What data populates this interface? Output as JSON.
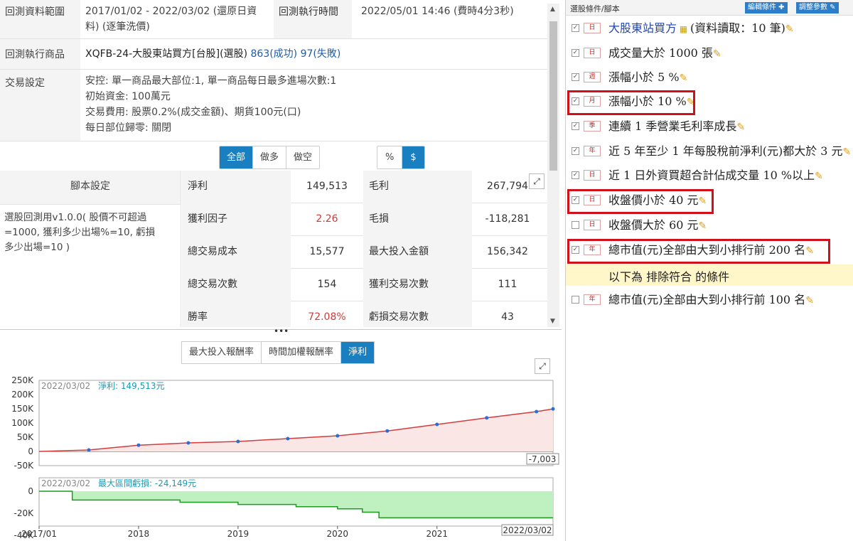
{
  "info": {
    "range_label": "回測資料範圍",
    "range_value_line1": "2017/01/02 - 2022/03/02 (還原日資",
    "range_value_line2": "料) (逐筆洗價)",
    "exec_time_label": "回測執行時間",
    "exec_time_value": "2022/05/01 14:46 (費時4分3秒)",
    "product_label": "回測執行商品",
    "product_value": "XQFB-24-大股東站買方[台股](選股)",
    "product_success": "863(成功)",
    "product_fail": "97(失敗)",
    "trade_label": "交易設定",
    "trade_lines": [
      "安控: 單一商品最大部位:1, 單一商品每日最多進場次數:1",
      "初始資金: 100萬元",
      "交易費用: 股票0.2%(成交金額)、期貨100元(口)",
      "每日部位歸零: 關閉"
    ]
  },
  "filters": {
    "direction": [
      "全部",
      "做多",
      "做空"
    ],
    "direction_active": "全部",
    "unit": [
      "%",
      "$"
    ],
    "unit_active": "$"
  },
  "script": {
    "header": "腳本設定",
    "text_lines": [
      "選股回測用v1.0.0( 股價不可超過",
      "=1000, 獲利多少出場%=10, 虧損",
      "多少出場=10 )"
    ]
  },
  "stats": [
    {
      "label": "淨利",
      "value": "149,513",
      "label2": "毛利",
      "value2": "267,794"
    },
    {
      "label": "獲利因子",
      "value": "2.26",
      "label2": "毛損",
      "value2": "-118,281",
      "value_red": true
    },
    {
      "label": "總交易成本",
      "value": "15,577",
      "label2": "最大投入金額",
      "value2": "156,342"
    },
    {
      "label": "總交易次數",
      "value": "154",
      "label2": "獲利交易次數",
      "value2": "111"
    },
    {
      "label": "勝率",
      "value": "72.08%",
      "label2": "虧損交易次數",
      "value2": "43",
      "value_red": true
    }
  ],
  "chart_tabs": [
    "最大投入報酬率",
    "時間加權報酬率",
    "淨利"
  ],
  "chart_tab_active": "淨利",
  "chart_data": [
    {
      "type": "line",
      "title": "淨利",
      "date_label": "2022/03/02",
      "legend_value": "淨利: 149,513元",
      "last_value_label": "-7,003",
      "ylim": [
        -50000,
        250000
      ],
      "yticks": [
        "250K",
        "200K",
        "150K",
        "100K",
        "50K",
        "0",
        "-50K"
      ],
      "x": [
        "2017/01",
        "2017/07",
        "2018/01",
        "2018/07",
        "2019/01",
        "2019/07",
        "2020/01",
        "2020/07",
        "2021/01",
        "2021/07",
        "2022/01",
        "2022/03"
      ],
      "values": [
        0,
        5000,
        22000,
        30000,
        35000,
        45000,
        55000,
        72000,
        95000,
        118000,
        140000,
        149513
      ],
      "colors": {
        "line": "#d13c3c",
        "markers": "#2a6fd6",
        "fill": "#fbe6e6"
      }
    },
    {
      "type": "area",
      "title": "最大區間虧損",
      "date_label": "2022/03/02",
      "legend_value": "最大區間虧損: -24,149元",
      "ylim": [
        -40000,
        0
      ],
      "yticks": [
        "0",
        "-20K",
        "-40K"
      ],
      "x": [
        "2017/01",
        "2017/05",
        "2018/06",
        "2019/01",
        "2019/08",
        "2020/01",
        "2020/04",
        "2020/06",
        "2022/03"
      ],
      "values": [
        0,
        -8000,
        -10000,
        -12000,
        -14000,
        -16000,
        -19000,
        -24149,
        -24149
      ],
      "colors": {
        "line": "#1f9a1f",
        "fill": "#bff0bf"
      },
      "xticks": [
        "2017/01",
        "2018",
        "2019",
        "2020",
        "2021",
        "2022/03/02"
      ]
    }
  ],
  "right": {
    "title": "選股條件/腳本",
    "edit_btn": "編輯條件",
    "param_btn": "調整參數",
    "conditions": [
      {
        "period": "日",
        "text": "大股東站買方",
        "suffix": "(資料讀取：10 筆)",
        "checked": true,
        "link": true
      },
      {
        "period": "日",
        "text": "成交量大於 1000 張",
        "checked": true
      },
      {
        "period": "週",
        "text": "漲幅小於 5 %",
        "checked": true
      },
      {
        "period": "月",
        "text": "漲幅小於 10 %",
        "checked": true
      },
      {
        "period": "季",
        "text": "連續 1 季營業毛利率成長",
        "checked": true
      },
      {
        "period": "年",
        "text": "近 5 年至少 1 年每股稅前淨利(元)都大於 3 元",
        "checked": true
      },
      {
        "period": "日",
        "text": "近 1 日外資買超合計佔成交量 10 %以上",
        "checked": true
      },
      {
        "period": "日",
        "text": "收盤價小於 40 元",
        "checked": true
      },
      {
        "period": "日",
        "text": "收盤價大於 60 元",
        "checked": false
      },
      {
        "period": "年",
        "text": "總市值(元)全部由大到小排行前 200 名",
        "checked": true
      }
    ],
    "exclude_label": "以下為 排除符合 的條件",
    "exclude_conditions": [
      {
        "period": "年",
        "text": "總市值(元)全部由大到小排行前 100 名",
        "checked": false
      }
    ]
  }
}
